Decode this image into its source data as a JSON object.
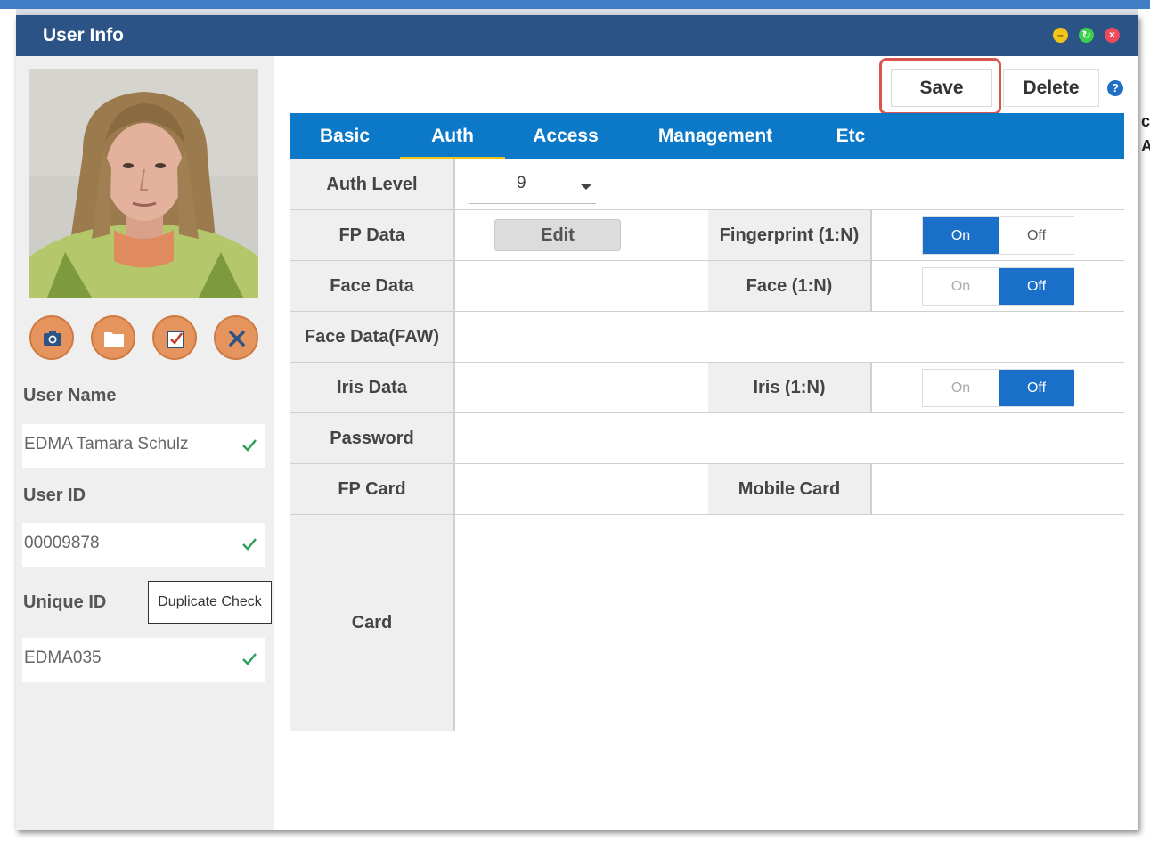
{
  "window": {
    "title": "User Info"
  },
  "toolbar": {
    "save_label": "Save",
    "delete_label": "Delete",
    "help_glyph": "?"
  },
  "background": {
    "right_text": "c\nA"
  },
  "photo_actions": [
    {
      "icon": "camera-icon"
    },
    {
      "icon": "folder-icon"
    },
    {
      "icon": "checkbox-icon"
    },
    {
      "icon": "close-icon"
    }
  ],
  "user": {
    "name_label": "User Name",
    "name_value": "EDMA Tamara Schulz",
    "id_label": "User ID",
    "id_value": "00009878",
    "unique_label": "Unique ID",
    "unique_value": "EDMA035",
    "duplicate_check_label": "Duplicate Check"
  },
  "tabs": [
    {
      "label": "Basic",
      "active": false
    },
    {
      "label": "Auth",
      "active": true
    },
    {
      "label": "Access",
      "active": false
    },
    {
      "label": "Management",
      "active": false
    },
    {
      "label": "Etc",
      "active": false
    }
  ],
  "auth": {
    "auth_level_label": "Auth Level",
    "auth_level_value": "9",
    "fp_data_label": "FP Data",
    "fp_edit_label": "Edit",
    "fingerprint_label": "Fingerprint (1:N)",
    "fingerprint_state": "On",
    "face_data_label": "Face Data",
    "face_label": "Face (1:N)",
    "face_state": "Off",
    "face_faw_label": "Face Data(FAW)",
    "iris_data_label": "Iris Data",
    "iris_label": "Iris (1:N)",
    "iris_state": "Off",
    "password_label": "Password",
    "fp_card_label": "FP Card",
    "mobile_card_label": "Mobile Card",
    "card_label": "Card",
    "toggle_on": "On",
    "toggle_off": "Off"
  },
  "colors": {
    "titlebar": "#2b5386",
    "tabbar": "#0c79c8",
    "active_tab_underline": "#f0c419",
    "toggle_selected": "#1a6fc9",
    "photo_button": "#e4945c",
    "highlight": "#d9534f",
    "check": "#2e9e5b"
  }
}
